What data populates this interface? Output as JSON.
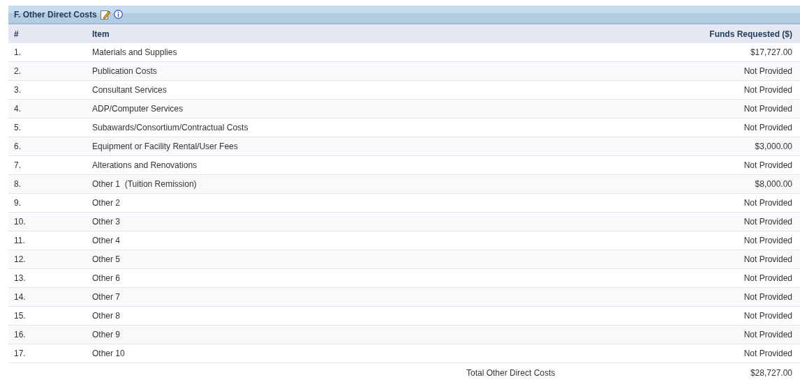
{
  "section": {
    "title": "F. Other Direct Costs"
  },
  "table": {
    "columns": [
      "#",
      "Item",
      "Funds Requested ($)"
    ],
    "rows": [
      {
        "number": "1.",
        "item": "Materials and Supplies",
        "funds": "$17,727.00"
      },
      {
        "number": "2.",
        "item": "Publication Costs",
        "funds": "Not Provided"
      },
      {
        "number": "3.",
        "item": "Consultant Services",
        "funds": "Not Provided"
      },
      {
        "number": "4.",
        "item": "ADP/Computer Services",
        "funds": "Not Provided"
      },
      {
        "number": "5.",
        "item": "Subawards/Consortium/Contractual Costs",
        "funds": "Not Provided"
      },
      {
        "number": "6.",
        "item": "Equipment or Facility Rental/User Fees",
        "funds": "$3,000.00"
      },
      {
        "number": "7.",
        "item": "Alterations and Renovations",
        "funds": "Not Provided"
      },
      {
        "number": "8.",
        "item": "Other 1  (Tuition Remission)",
        "funds": "$8,000.00"
      },
      {
        "number": "9.",
        "item": "Other 2",
        "funds": "Not Provided"
      },
      {
        "number": "10.",
        "item": "Other 3",
        "funds": "Not Provided"
      },
      {
        "number": "11.",
        "item": "Other 4",
        "funds": "Not Provided"
      },
      {
        "number": "12.",
        "item": "Other 5",
        "funds": "Not Provided"
      },
      {
        "number": "13.",
        "item": "Other 6",
        "funds": "Not Provided"
      },
      {
        "number": "14.",
        "item": "Other 7",
        "funds": "Not Provided"
      },
      {
        "number": "15.",
        "item": "Other 8",
        "funds": "Not Provided"
      },
      {
        "number": "16.",
        "item": "Other 9",
        "funds": "Not Provided"
      },
      {
        "number": "17.",
        "item": "Other 10",
        "funds": "Not Provided"
      }
    ],
    "total": {
      "label": "Total Other Direct Costs",
      "value": "$28,727.00"
    }
  }
}
